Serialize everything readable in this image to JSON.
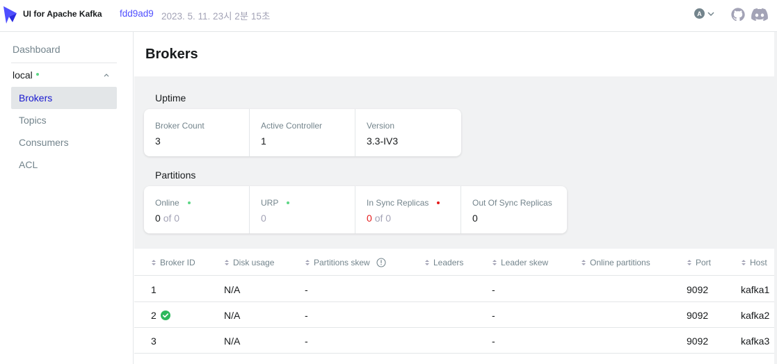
{
  "header": {
    "app_title": "UI for Apache Kafka",
    "commit": "fdd9ad9",
    "build_date": "2023. 5. 11. 23시 2분 15초",
    "user_initial": "A"
  },
  "sidebar": {
    "dashboard": "Dashboard",
    "cluster": "local",
    "items": [
      {
        "label": "Brokers",
        "active": true
      },
      {
        "label": "Topics"
      },
      {
        "label": "Consumers"
      },
      {
        "label": "ACL"
      }
    ]
  },
  "page": {
    "title": "Brokers",
    "uptime": {
      "section_title": "Uptime",
      "metrics": [
        {
          "label": "Broker Count",
          "value": "3"
        },
        {
          "label": "Active Controller",
          "value": "1"
        },
        {
          "label": "Version",
          "value": "3.3-IV3"
        }
      ]
    },
    "partitions": {
      "section_title": "Partitions",
      "online": {
        "label": "Online",
        "value": "0",
        "of": "of 0"
      },
      "urp": {
        "label": "URP",
        "value": "0"
      },
      "in_sync": {
        "label": "In Sync Replicas",
        "value": "0",
        "of": "of 0"
      },
      "out_of_sync": {
        "label": "Out Of Sync Replicas",
        "value": "0"
      }
    }
  },
  "table": {
    "columns": [
      "Broker ID",
      "Disk usage",
      "Partitions skew",
      "Leaders",
      "Leader skew",
      "Online partitions",
      "Port",
      "Host"
    ],
    "rows": [
      {
        "id": "1",
        "disk": "N/A",
        "partitions_skew": "-",
        "leaders": "",
        "leader_skew": "-",
        "online_partitions": "",
        "port": "9092",
        "host": "kafka1"
      },
      {
        "id": "2",
        "disk": "N/A",
        "partitions_skew": "-",
        "leaders": "",
        "leader_skew": "-",
        "online_partitions": "",
        "port": "9092",
        "host": "kafka2"
      },
      {
        "id": "3",
        "disk": "N/A",
        "partitions_skew": "-",
        "leaders": "",
        "leader_skew": "-",
        "online_partitions": "",
        "port": "9092",
        "host": "kafka3"
      }
    ]
  },
  "colors": {
    "accent": "#4f4fff",
    "active_nav": "#1717cf",
    "green": "#5cd685",
    "red": "#e51a1a"
  }
}
